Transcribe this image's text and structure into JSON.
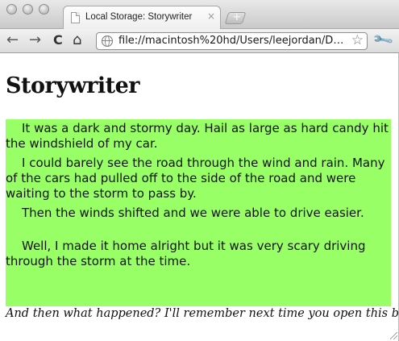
{
  "browser": {
    "tab": {
      "title": "Local Storage: Storywriter",
      "close": "×",
      "favicon": "page-icon"
    },
    "new_tab": "+",
    "toolbar": {
      "back": "←",
      "forward": "→",
      "reload": "C",
      "home": "⌂"
    },
    "omnibox": {
      "url": "file://macintosh%20hd/Users/leejordan/D…",
      "site_icon": "globe-icon",
      "bookmark": "☆"
    },
    "menu": "wrench-icon"
  },
  "page": {
    "heading": "Storywriter",
    "story": [
      "It was a dark and stormy day.  Hail as large as hard candy hit the windshield of my car.",
      "I could barely see the road through the wind and rain. Many of the cars had pulled off to the side of the road and were waiting to the storm to pass by.",
      "Then the winds shifted and we were able to drive easier.",
      "Well, I made it home alright but it was very scary driving through the storm at the time."
    ],
    "caption": "And then what happened? I'll remember next time you open this browser.",
    "story_bg": "#99ff66"
  }
}
